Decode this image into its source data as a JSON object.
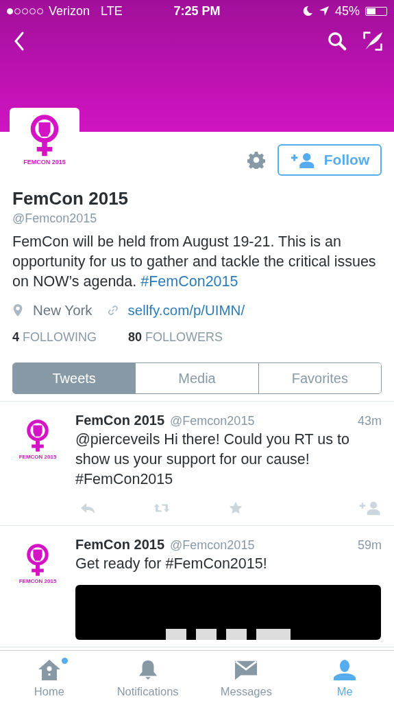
{
  "status_bar": {
    "carrier": "Verizon",
    "network": "LTE",
    "time": "7:25 PM",
    "battery": "45%"
  },
  "profile": {
    "logo_caption": "FEMCON 2015",
    "follow_button": "Follow",
    "name": "FemCon 2015",
    "handle": "@Femcon2015",
    "bio": "FemCon will be held from August 19-21. This is an opportunity for us to gather and tackle the critical issues on NOW’s agenda.",
    "bio_hashtag": "#FemCon2015",
    "location": "New York",
    "website": "sellfy.com/p/UIMN/",
    "stats": [
      {
        "count": "4",
        "label": "FOLLOWING"
      },
      {
        "count": "80",
        "label": "FOLLOWERS"
      }
    ]
  },
  "tabs": [
    {
      "label": "Tweets",
      "selected": true
    },
    {
      "label": "Media",
      "selected": false
    },
    {
      "label": "Favorites",
      "selected": false
    }
  ],
  "tweets": [
    {
      "logo_caption": "FEMCON 2015",
      "name": "FemCon 2015",
      "handle": "@Femcon2015",
      "time": "43m",
      "text": "@pierceveils Hi there! Could you RT us to show us your support for our cause! #FemCon2015",
      "kind": "text"
    },
    {
      "logo_caption": "FEMCON 2015",
      "name": "FemCon 2015",
      "handle": "@Femcon2015",
      "time": "59m",
      "text": "Get ready for #FemCon2015!",
      "kind": "media"
    }
  ],
  "tab_bar": [
    {
      "label": "Home",
      "kind": "home",
      "selected": false,
      "badge": true
    },
    {
      "label": "Notifications",
      "kind": "bell",
      "selected": false,
      "badge": false
    },
    {
      "label": "Messages",
      "kind": "mail",
      "selected": false,
      "badge": false
    },
    {
      "label": "Me",
      "kind": "person",
      "selected": true,
      "badge": false
    }
  ]
}
